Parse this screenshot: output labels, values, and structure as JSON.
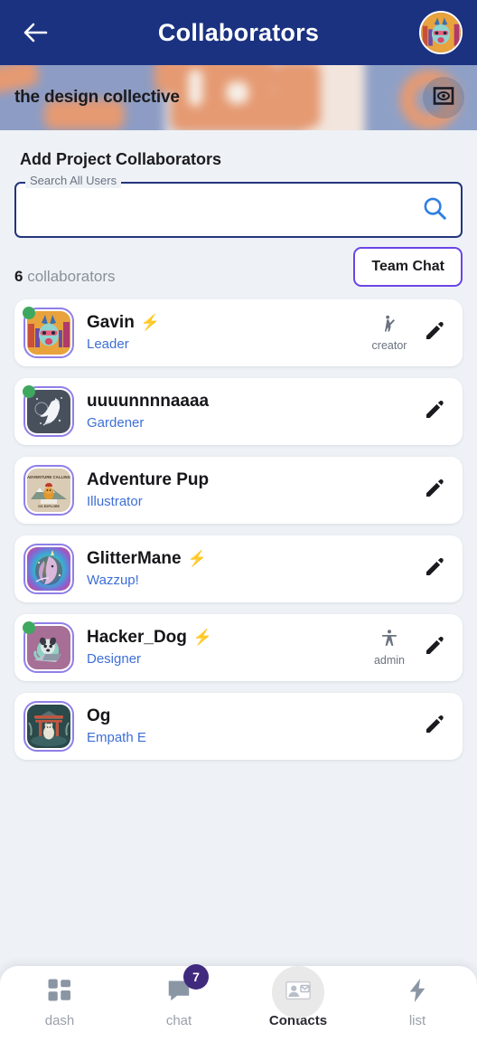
{
  "appbar": {
    "title": "Collaborators",
    "back_icon": "arrow-left-icon",
    "avatar_icon": "user-avatar",
    "bg_color": "#1b3281"
  },
  "banner": {
    "project_name": "the design collective",
    "visibility_icon": "eye-preview-icon"
  },
  "add_section": {
    "heading": "Add Project Collaborators",
    "search_label": "Search All Users",
    "search_value": "",
    "search_placeholder": "",
    "search_icon": "search-icon"
  },
  "meta": {
    "count": "6",
    "count_label": "collaborators",
    "team_chat_label": "Team Chat",
    "team_chat_border": "#6b46e5"
  },
  "collaborators": [
    {
      "name": "Gavin",
      "role": "Leader",
      "has_bolt": true,
      "online": true,
      "tag": "creator",
      "tag_icon": "person-waving-icon",
      "avatar_name": "avatar-gavin"
    },
    {
      "name": "uuuunnnnaaaa",
      "role": "Gardener",
      "has_bolt": false,
      "online": true,
      "tag": "",
      "tag_icon": "",
      "avatar_name": "avatar-uuuunnnnaaaa"
    },
    {
      "name": "Adventure Pup",
      "role": "Illustrator",
      "has_bolt": false,
      "online": false,
      "tag": "",
      "tag_icon": "",
      "avatar_name": "avatar-adventure-pup"
    },
    {
      "name": "GlitterMane",
      "role": "Wazzup!",
      "has_bolt": true,
      "online": false,
      "tag": "",
      "tag_icon": "",
      "avatar_name": "avatar-glittermane"
    },
    {
      "name": "Hacker_Dog",
      "role": "Designer",
      "has_bolt": true,
      "online": true,
      "tag": "admin",
      "tag_icon": "person-accessibility-icon",
      "avatar_name": "avatar-hacker-dog"
    },
    {
      "name": "Og",
      "role": "Empath E",
      "has_bolt": false,
      "online": false,
      "tag": "",
      "tag_icon": "",
      "avatar_name": "avatar-og"
    }
  ],
  "row_edit_label": "edit",
  "bottom_nav": {
    "items": [
      {
        "label": "dash",
        "icon": "grid-dashboard-icon",
        "active": false,
        "badge": ""
      },
      {
        "label": "chat",
        "icon": "chat-bubble-icon",
        "active": false,
        "badge": "7"
      },
      {
        "label": "Contacts",
        "icon": "contact-card-icon",
        "active": true,
        "badge": ""
      },
      {
        "label": "list",
        "icon": "lightning-bolt-icon",
        "active": false,
        "badge": ""
      }
    ],
    "badge_color": "#3f2a7e"
  }
}
